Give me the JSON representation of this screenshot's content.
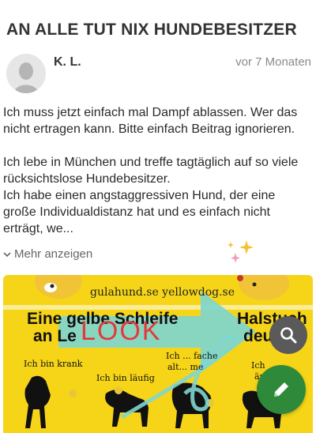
{
  "post": {
    "title": "AN ALLE TUT NIX HUNDEBESITZER",
    "author": "K. L.",
    "time": "vor 7 Monaten",
    "paragraph1": "Ich muss jetzt einfach mal Dampf ablassen. Wer das nicht ertragen kann. Bitte einfach Beitrag ignorieren.",
    "paragraph2": "Ich lebe in München und treffe tagtäglich auf so viele rücksichtslose Hundebesitzer.",
    "paragraph3": "Ich habe einen angstaggressiven Hund, der eine große Individualdistanz hat und es einfach nicht erträgt, we...",
    "more_label": "Mehr anzeigen"
  },
  "image": {
    "site_text": "gulahund.se  yellowdog.se",
    "headline_left": "Eine gelbe Schleife",
    "headline_left2": "an Le",
    "headline_right": "Halstuch",
    "headline_right2": "deut",
    "label1": "Ich bin krank",
    "label2": "Ich bin läufig",
    "label3": "Ich ... fache",
    "label3b": "alt... me",
    "label4": "Ich",
    "label4b": "än",
    "sticker_text": "LOOK",
    "colors": {
      "background": "#f6d518",
      "arrow": "#7fd6cf",
      "ribbon": "#e9c53a"
    }
  },
  "fabs": {
    "search_icon": "search-icon",
    "edit_icon": "pencil-icon"
  }
}
